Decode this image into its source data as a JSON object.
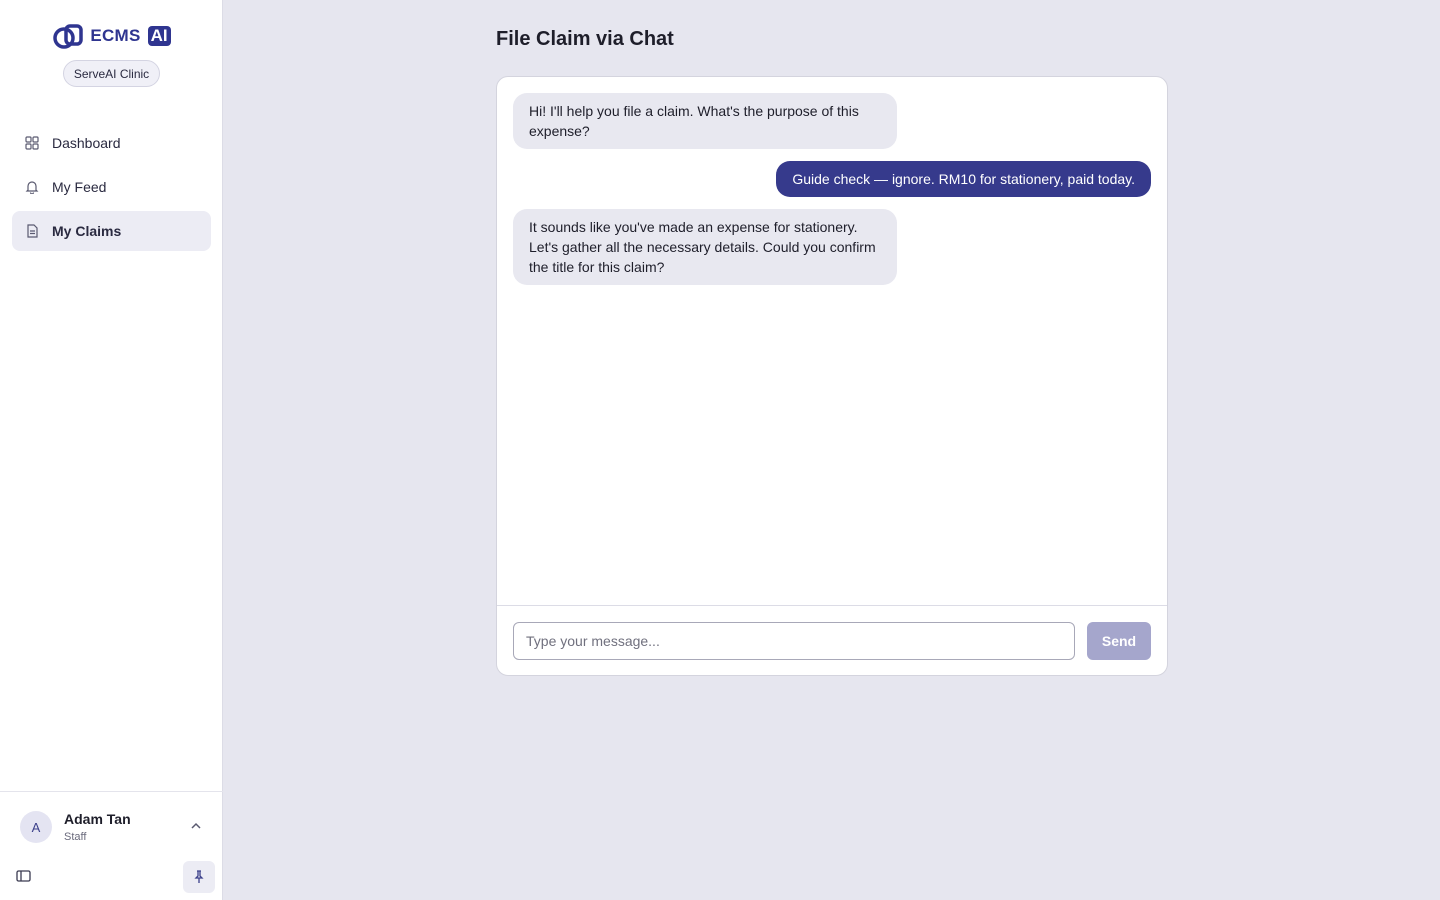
{
  "brand": {
    "name": "ECMS",
    "ai": "AI",
    "org": "ServeAI Clinic"
  },
  "nav": [
    {
      "label": "Dashboard",
      "icon": "grid-icon",
      "active": false
    },
    {
      "label": "My Feed",
      "icon": "bell-icon",
      "active": false
    },
    {
      "label": "My Claims",
      "icon": "document-icon",
      "active": true
    }
  ],
  "user": {
    "initial": "A",
    "name": "Adam Tan",
    "role": "Staff"
  },
  "page": {
    "title": "File Claim via Chat"
  },
  "chat": {
    "messages": [
      {
        "sender": "bot",
        "text": "Hi! I'll help you file a claim. What's the purpose of this expense?"
      },
      {
        "sender": "user",
        "text": "Guide check — ignore. RM10 for stationery, paid today."
      },
      {
        "sender": "bot",
        "text": "It sounds like you've made an expense for stationery. Let's gather all the necessary details. Could you confirm the title for this claim?"
      }
    ],
    "input_placeholder": "Type your message...",
    "input_value": "",
    "send_label": "Send"
  },
  "colors": {
    "accent": "#363a8c",
    "brand": "#2f3590",
    "send_disabled": "#a5a6cc",
    "background": "#e6e6ef"
  }
}
